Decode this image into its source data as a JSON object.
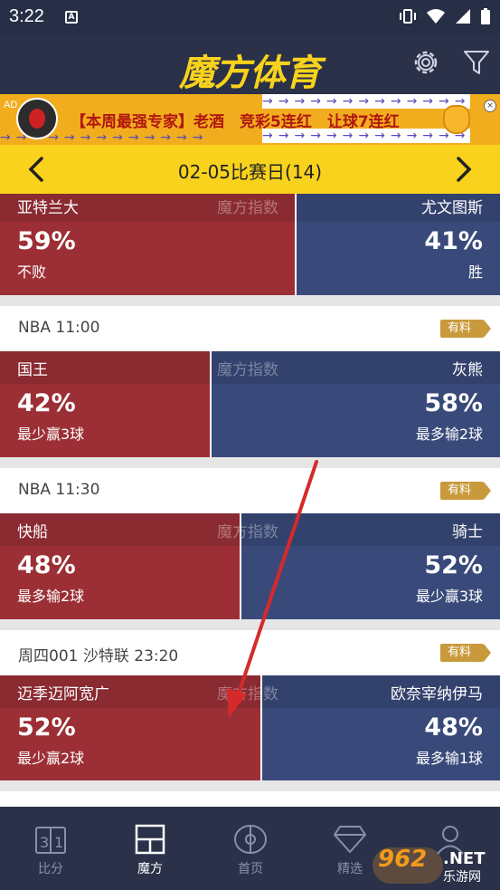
{
  "status_bar": {
    "time": "3:22",
    "a_badge": "A"
  },
  "header": {
    "logo": "魔方体育",
    "settings_icon": "gear-icon",
    "filter_icon": "funnel-icon"
  },
  "ad": {
    "tag": "AD",
    "text": "【本周最强专家】老酒　竞彩5连红　让球7连红",
    "arrows": "→→→→→→→→→→→→→",
    "close": "×"
  },
  "date_bar": {
    "label": "02-05比赛日(14)"
  },
  "index_label": "魔方指数",
  "partial_game": {
    "home": "亚特兰大",
    "away": "尤文图斯",
    "home_pct": "59%",
    "away_pct": "41%",
    "home_note": "不败",
    "away_note": "胜",
    "home_share": 0.59
  },
  "games": [
    {
      "league_time": "NBA  11:00",
      "tag": "有料",
      "home": "国王",
      "away": "灰熊",
      "home_pct": "42%",
      "away_pct": "58%",
      "home_note": "最少赢3球",
      "away_note": "最多输2球",
      "home_share": 0.42
    },
    {
      "league_time": "NBA  11:30",
      "tag": "有料",
      "home": "快船",
      "away": "骑士",
      "home_pct": "48%",
      "away_pct": "52%",
      "home_note": "最多输2球",
      "away_note": "最少赢3球",
      "home_share": 0.48
    },
    {
      "league_time": "周四001  沙特联  23:20",
      "tag": "有料",
      "home": "迈季迈阿宽广",
      "away": "欧奈宰纳伊马",
      "home_pct": "52%",
      "away_pct": "48%",
      "home_note": "最少赢2球",
      "away_note": "最多输1球",
      "home_share": 0.52
    }
  ],
  "bottom_nav": [
    {
      "label": "比分",
      "icon": "scoreboard-icon",
      "active": false
    },
    {
      "label": "魔方",
      "icon": "cube-grid-icon",
      "active": true
    },
    {
      "label": "首页",
      "icon": "pitch-icon",
      "active": false
    },
    {
      "label": "精选",
      "icon": "diamond-icon",
      "active": false
    },
    {
      "label": "",
      "icon": "user-icon",
      "active": false
    }
  ],
  "watermark": {
    "number": "962",
    "suffix": ".NET",
    "subtitle": "乐游网"
  },
  "colors": {
    "yellow": "#f8d21c",
    "navy": "#2a3149",
    "red": "#9c2f35",
    "blue": "#394a7a",
    "tag": "#c99a3c",
    "annotation_arrow": "#d62a2a"
  }
}
